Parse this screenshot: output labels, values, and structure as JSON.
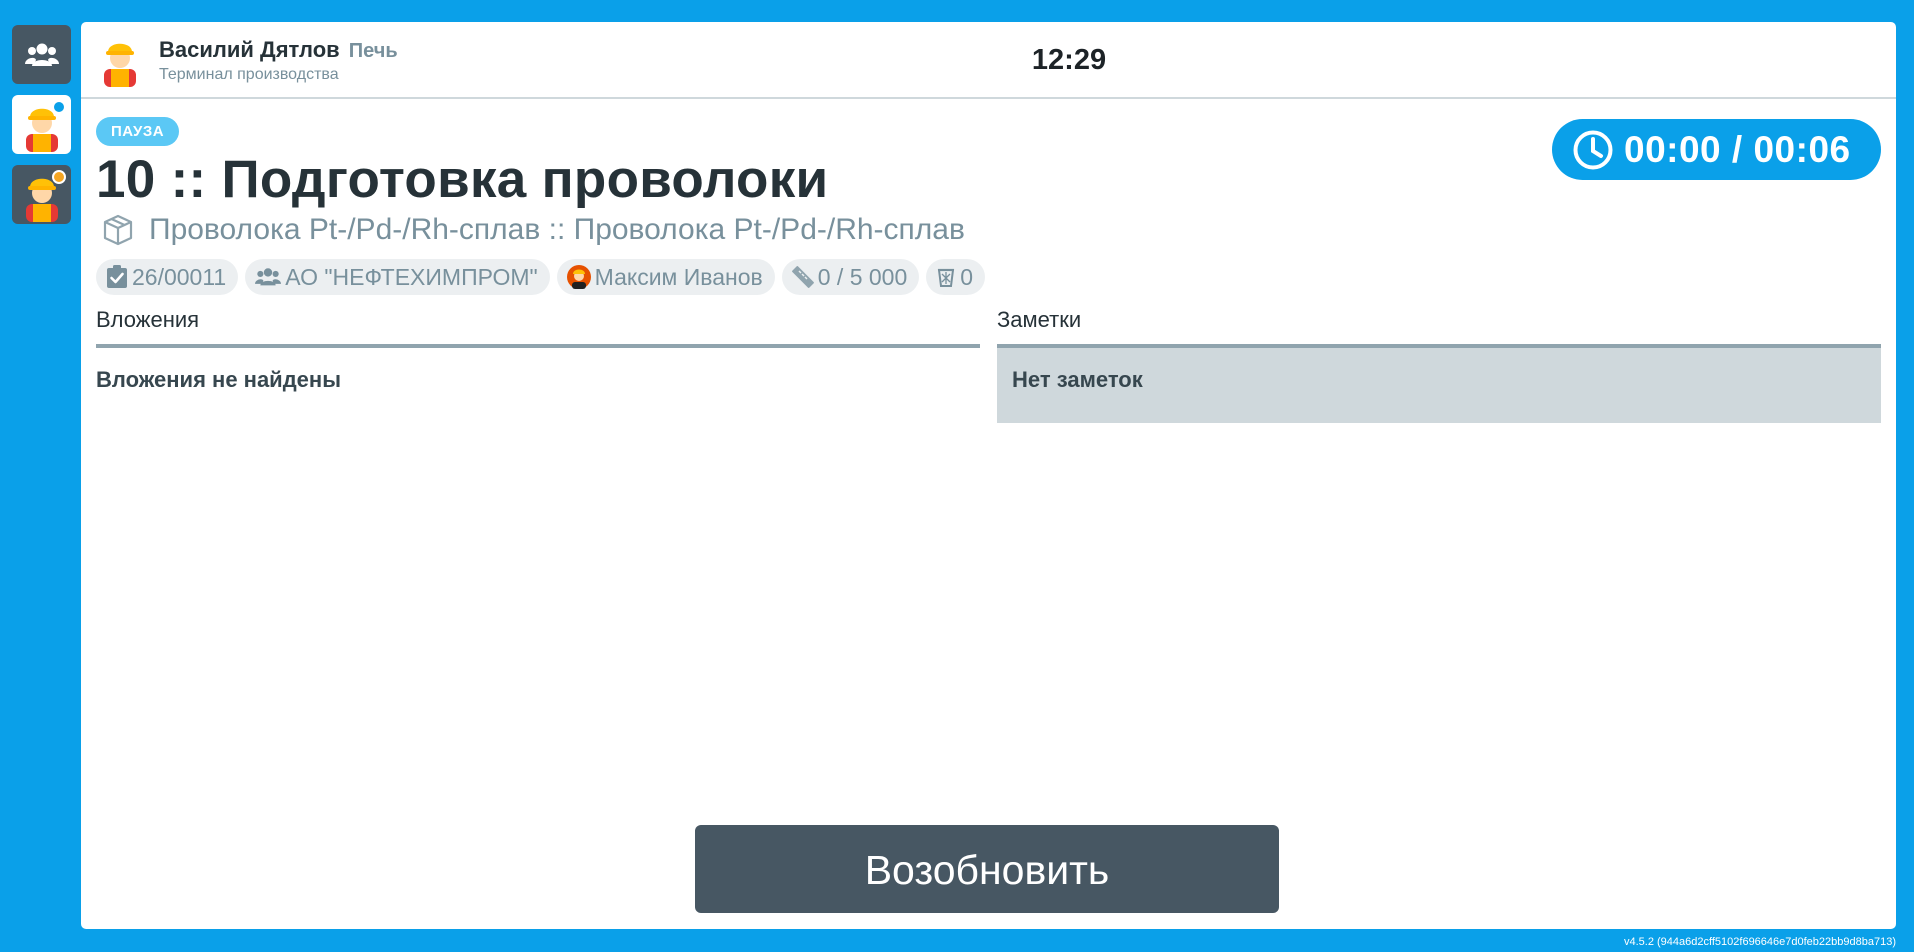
{
  "sidebar": {
    "items": [
      {
        "icon": "users-icon"
      },
      {
        "icon": "worker-avatar-icon",
        "status_color": "#0aa0e9"
      },
      {
        "icon": "worker-avatar-icon",
        "status_color": "#f5a623"
      }
    ]
  },
  "header": {
    "user_name": "Василий Дятлов",
    "station": "Печь",
    "subtitle": "Терминал производства",
    "clock": "12:29"
  },
  "task": {
    "status": "ПАУЗА",
    "timer": "00:00 / 00:06",
    "title": "10 :: Подготовка проволоки",
    "product": "Проволока Pt-/Pd-/Rh-сплав :: Проволока Pt-/Pd-/Rh-сплав",
    "chips": {
      "order": "26/00011",
      "customer": "АО \"НЕФТЕХИМПРОМ\"",
      "operator": "Максим Иванов",
      "quantity": "0 / 5 000",
      "waste": "0"
    }
  },
  "attachments": {
    "title": "Вложения",
    "empty": "Вложения не найдены"
  },
  "notes": {
    "title": "Заметки",
    "empty": "Нет заметок"
  },
  "actions": {
    "resume": "Возобновить"
  },
  "footer": {
    "version": "v4.5.2 (944a6d2cff5102f696646e7d0feb22bb9d8ba713)"
  },
  "colors": {
    "brand": "#0aa0e9",
    "dark": "#475763",
    "badge": "#5bc8f5"
  }
}
